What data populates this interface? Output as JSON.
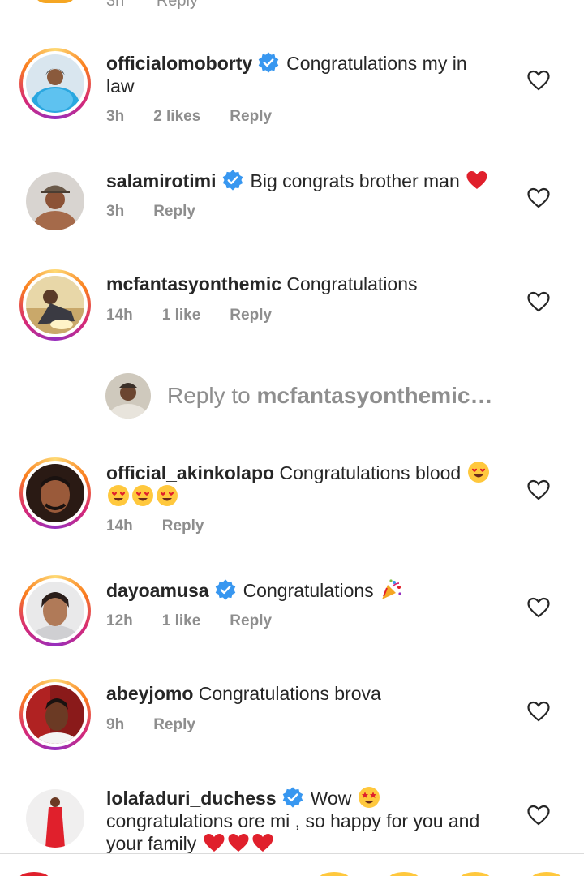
{
  "top": {
    "time": "3h",
    "reply": "Reply"
  },
  "comments": [
    {
      "username": "officialomoborty",
      "verified": true,
      "text_lines": [
        "Congratulations my in",
        "law"
      ],
      "time": "3h",
      "likes": "2 likes",
      "reply": "Reply",
      "ring": true
    },
    {
      "username": "salamirotimi",
      "verified": true,
      "text": "Big congrats brother man",
      "time": "3h",
      "likes": "",
      "reply": "Reply",
      "ring": false
    },
    {
      "username": "mcfantasyonthemic",
      "verified": false,
      "text": "Congratulations",
      "time": "14h",
      "likes": "1 like",
      "reply": "Reply",
      "ring": true
    },
    {
      "username": "official_akinkolapo",
      "verified": false,
      "text": "Congratulations blood",
      "time": "14h",
      "likes": "",
      "reply": "Reply",
      "ring": true
    },
    {
      "username": "dayoamusa",
      "verified": true,
      "text": "Congratulations",
      "time": "12h",
      "likes": "1 like",
      "reply": "Reply",
      "ring": true
    },
    {
      "username": "abeyjomo",
      "verified": false,
      "text": "Congratulations brova",
      "time": "9h",
      "likes": "",
      "reply": "Reply",
      "ring": true
    },
    {
      "username": "lolafaduri_duchess",
      "verified": true,
      "text_lines": [
        "Wow",
        "congratulations ore mi , so happy for you and",
        "your family"
      ],
      "ring": false
    }
  ],
  "reply_box": {
    "prefix": "Reply to",
    "target": "mcfantasyonthemic…"
  },
  "icons": {
    "verified": "verified-badge-icon",
    "like": "heart-outline-icon"
  },
  "colors": {
    "verified_blue": "#3897f0",
    "muted": "#8e8e8e",
    "text": "#262626",
    "heart_red": "#e0202c"
  }
}
